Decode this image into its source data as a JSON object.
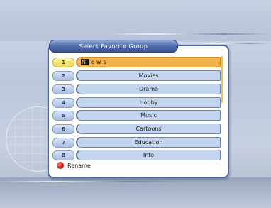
{
  "dialog": {
    "title": "Select Favorite Group",
    "selected_index": 0,
    "groups": [
      {
        "number": "1",
        "name": "News",
        "cursor_char": "N",
        "rest": "ews"
      },
      {
        "number": "2",
        "name": "Movies"
      },
      {
        "number": "3",
        "name": "Drama"
      },
      {
        "number": "4",
        "name": "Hobby"
      },
      {
        "number": "5",
        "name": "Music"
      },
      {
        "number": "6",
        "name": "Cartoons"
      },
      {
        "number": "7",
        "name": "Education"
      },
      {
        "number": "8",
        "name": "Info"
      }
    ],
    "footer": {
      "rename_label": "Rename",
      "rename_key_icon": "red-button-icon"
    }
  },
  "colors": {
    "selected_row": "#f6b24a",
    "selected_number": "#e9d74e",
    "row_fill": "#c2d4ee",
    "frame": "#4f6aa3",
    "red_key": "#d41a12"
  }
}
